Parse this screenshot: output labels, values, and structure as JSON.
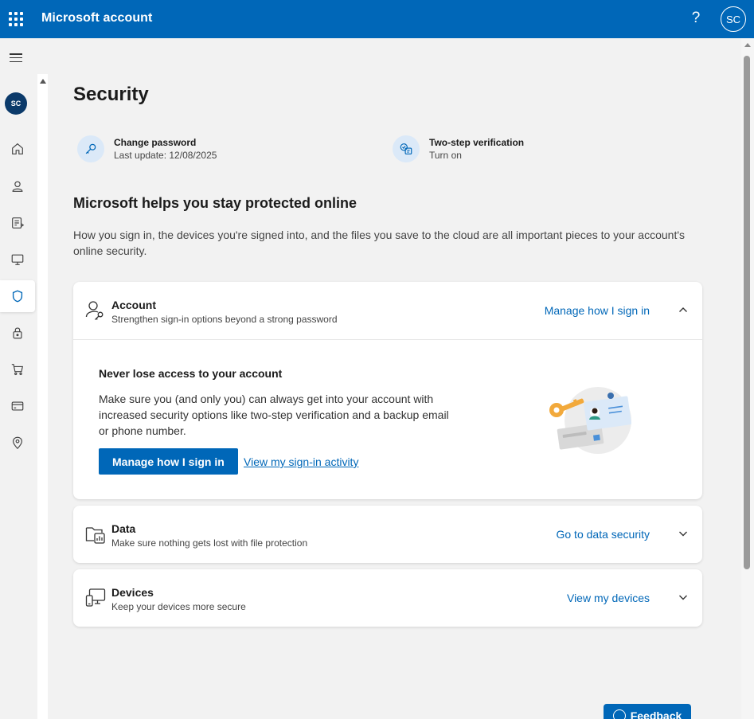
{
  "header": {
    "app_title": "Microsoft account",
    "help_glyph": "?",
    "avatar_initials": "SC"
  },
  "nav": {
    "avatar_initials": "SC",
    "items": [
      {
        "icon": "home-icon"
      },
      {
        "icon": "person-icon"
      },
      {
        "icon": "subscriptions-icon"
      },
      {
        "icon": "devices-icon"
      },
      {
        "icon": "shield-icon",
        "active": true
      },
      {
        "icon": "lock-icon"
      },
      {
        "icon": "cart-icon"
      },
      {
        "icon": "card-icon"
      },
      {
        "icon": "location-pin-icon"
      }
    ]
  },
  "page": {
    "title": "Security",
    "quick_actions": [
      {
        "icon": "key-icon",
        "title": "Change password",
        "subtitle": "Last update: 12/08/2025"
      },
      {
        "icon": "two-step-icon",
        "title": "Two-step verification",
        "subtitle": "Turn on"
      }
    ],
    "section_heading": "Microsoft helps you stay protected online",
    "section_desc": "How you sign in, the devices you're signed into, and the files you save to the cloud are all important pieces to your account's online security."
  },
  "cards": {
    "account": {
      "title": "Account",
      "subtitle": "Strengthen sign-in options beyond a strong password",
      "link": "Manage how I sign in",
      "expanded": true,
      "body": {
        "title": "Never lose access to your account",
        "text": "Make sure you (and only you) can always get into your account with increased security options like two-step verification and a backup email or phone number.",
        "primary_button": "Manage how I sign in",
        "secondary_link": "View my sign-in activity"
      }
    },
    "data": {
      "title": "Data",
      "subtitle": "Make sure nothing gets lost with file protection",
      "link": "Go to data security"
    },
    "devices": {
      "title": "Devices",
      "subtitle": "Keep your devices more secure",
      "link": "View my devices"
    }
  },
  "feedback": {
    "label": "Feedback"
  },
  "colors": {
    "brand": "#0067b8",
    "background": "#f2f2f2",
    "icon_bg": "#dbe9f8"
  }
}
